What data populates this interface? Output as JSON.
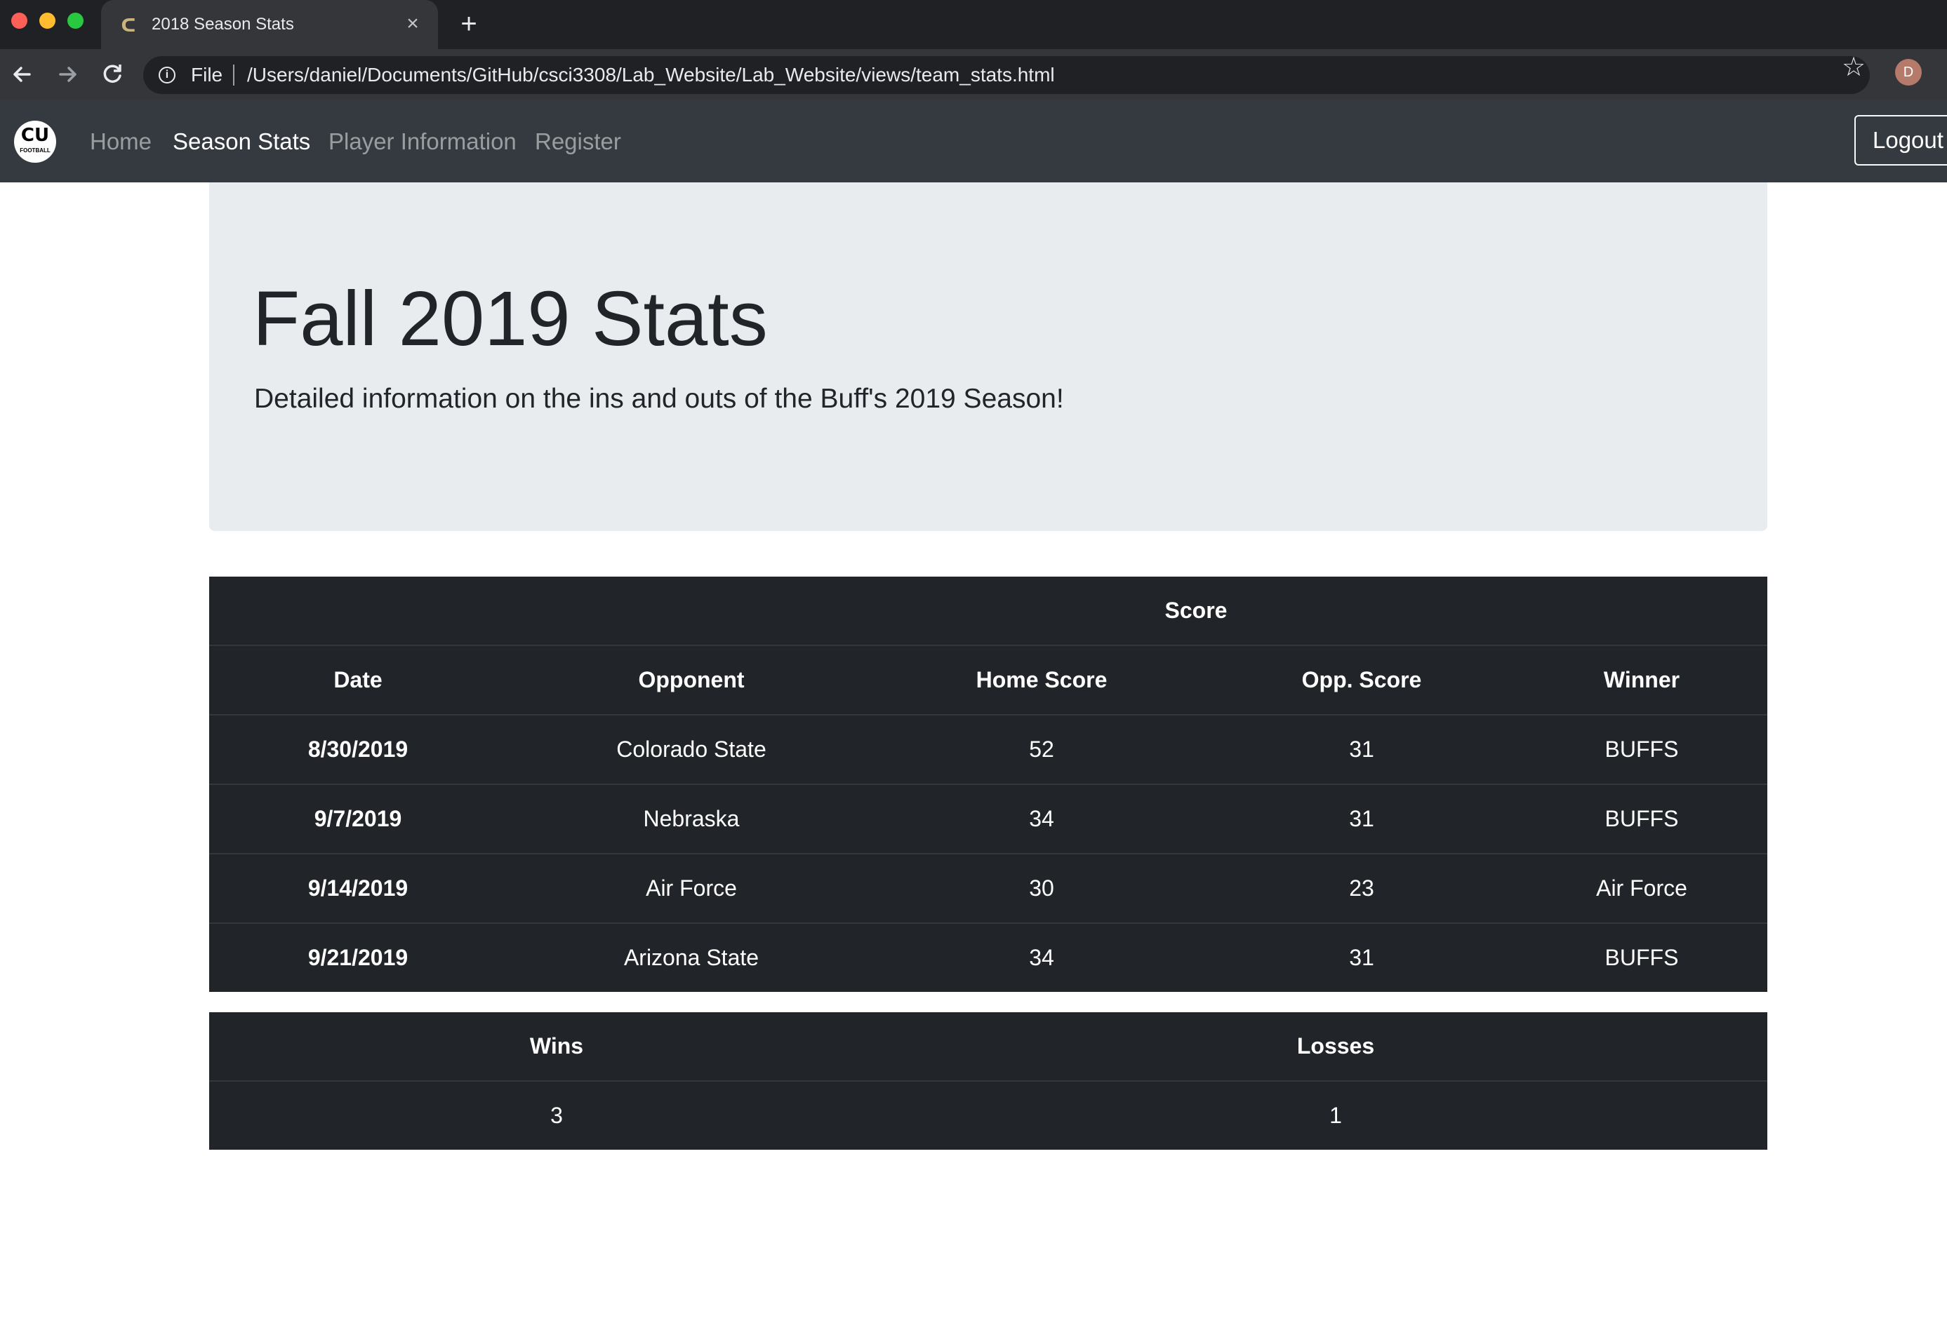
{
  "browser": {
    "tab_title": "2018 Season Stats",
    "tab_close": "×",
    "new_tab": "+",
    "scheme": "File",
    "url": "/Users/daniel/Documents/GitHub/csci3308/Lab_Website/Lab_Website/views/team_stats.html",
    "profile_initial": "D",
    "icons": {
      "back": "back-arrow-icon",
      "forward": "forward-arrow-icon",
      "reload": "reload-icon",
      "info": "info-icon",
      "bookmark": "star-icon"
    }
  },
  "navbar": {
    "logo_mono": "CU",
    "logo_text": "FOOTBALL",
    "links": [
      {
        "label": "Home",
        "active": false
      },
      {
        "label": "Season Stats",
        "active": true
      },
      {
        "label": "Player Information",
        "active": false
      },
      {
        "label": "Register",
        "active": false
      }
    ],
    "logout_label": "Logout"
  },
  "jumbotron": {
    "title": "Fall 2019 Stats",
    "lead": "Detailed information on the ins and outs of the Buff's 2019 Season!"
  },
  "games_table": {
    "group_header": "Score",
    "headers": [
      "Date",
      "Opponent",
      "Home Score",
      "Opp. Score",
      "Winner"
    ],
    "rows": [
      {
        "date": "8/30/2019",
        "opponent": "Colorado State",
        "home_score": "52",
        "opp_score": "31",
        "winner": "BUFFS"
      },
      {
        "date": "9/7/2019",
        "opponent": "Nebraska",
        "home_score": "34",
        "opp_score": "31",
        "winner": "BUFFS"
      },
      {
        "date": "9/14/2019",
        "opponent": "Air Force",
        "home_score": "30",
        "opp_score": "23",
        "winner": "Air Force"
      },
      {
        "date": "9/21/2019",
        "opponent": "Arizona State",
        "home_score": "34",
        "opp_score": "31",
        "winner": "BUFFS"
      }
    ]
  },
  "record_table": {
    "headers": [
      "Wins",
      "Losses"
    ],
    "values": [
      "3",
      "1"
    ]
  },
  "colors": {
    "navbar": "#343a40",
    "table_dark": "#212529",
    "jumbotron": "#e9ecef"
  }
}
